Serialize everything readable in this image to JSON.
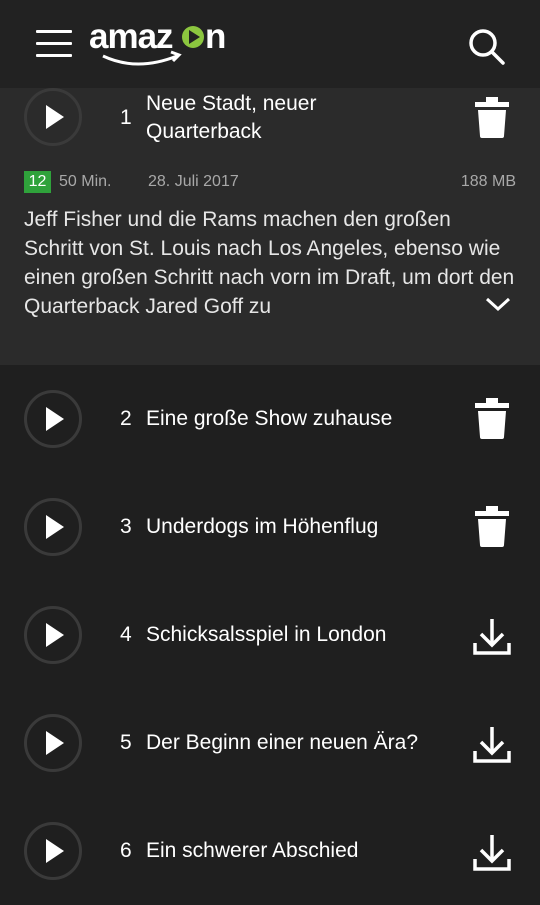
{
  "header": {
    "logo_text": "amazon",
    "menu_icon": "hamburger-menu-icon",
    "search_icon": "search-icon"
  },
  "episodes": [
    {
      "number": "1",
      "title_line1": "Neue Stadt, neuer",
      "title_line2": "Quarterback",
      "action": "delete",
      "age_rating": "12",
      "duration": "50 Min.",
      "date": "28. Juli 2017",
      "size": "188 MB",
      "description": "Jeff Fisher und die Rams machen den großen Schritt von St. Louis nach Los Angeles, ebenso wie einen großen Schritt nach vorn im Draft, um dort den Quarterback Jared Goff zu"
    },
    {
      "number": "2",
      "title": "Eine große Show zuhause",
      "action": "delete"
    },
    {
      "number": "3",
      "title": "Underdogs im Höhenflug",
      "action": "delete"
    },
    {
      "number": "4",
      "title": "Schicksalsspiel in London",
      "action": "download"
    },
    {
      "number": "5",
      "title": "Der Beginn einer neuen Ära?",
      "action": "download"
    },
    {
      "number": "6",
      "title": "Ein schwerer Abschied",
      "action": "download"
    }
  ],
  "colors": {
    "background": "#1f1f1f",
    "expanded_background": "#2b2b2b",
    "age_badge": "#2fa23b",
    "logo_accent": "#8cc63f"
  }
}
